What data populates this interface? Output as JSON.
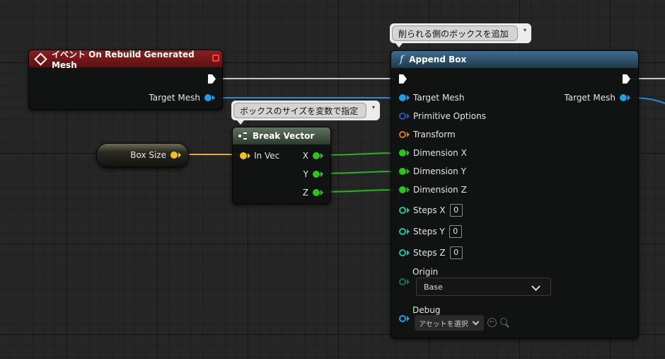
{
  "colors": {
    "exec_wire": "#d8d8d8",
    "mesh_pin": "#1ea0e6",
    "vector_pin": "#f0c21e",
    "float_pin": "#2dc41c",
    "struct_pin_options": "#1f5ab4",
    "transform_pin": "#e0701a",
    "int_pin": "#1fbfa0",
    "enum_pin": "#107060"
  },
  "comments": {
    "append_box": "削られる側のボックスを追加",
    "break_vector": "ボックスのサイズを変数で指定"
  },
  "event_node": {
    "title": "イベント On Rebuild Generated Mesh",
    "header_icon": "event-diamond-icon",
    "output_pin": "Target Mesh"
  },
  "variable_node": {
    "label": "Box Size"
  },
  "break_vector_node": {
    "title": "Break Vector",
    "header_icon": "break-struct-icon",
    "input_pin": "In Vec",
    "outputs": [
      "X",
      "Y",
      "Z"
    ]
  },
  "append_box_node": {
    "title": "Append Box",
    "header_icon": "function-f-icon",
    "header_glyph": "f",
    "inputs": {
      "target_mesh": "Target Mesh",
      "primitive_options": "Primitive Options",
      "transform": "Transform",
      "dimension_x": "Dimension X",
      "dimension_y": "Dimension Y",
      "dimension_z": "Dimension Z",
      "steps_x": "Steps X",
      "steps_y": "Steps Y",
      "steps_z": "Steps Z",
      "origin": "Origin",
      "debug": "Debug"
    },
    "steps_x_value": "0",
    "steps_y_value": "0",
    "steps_z_value": "0",
    "origin_value": "Base",
    "debug_value": "アセットを選択",
    "output_pin": "Target Mesh"
  }
}
